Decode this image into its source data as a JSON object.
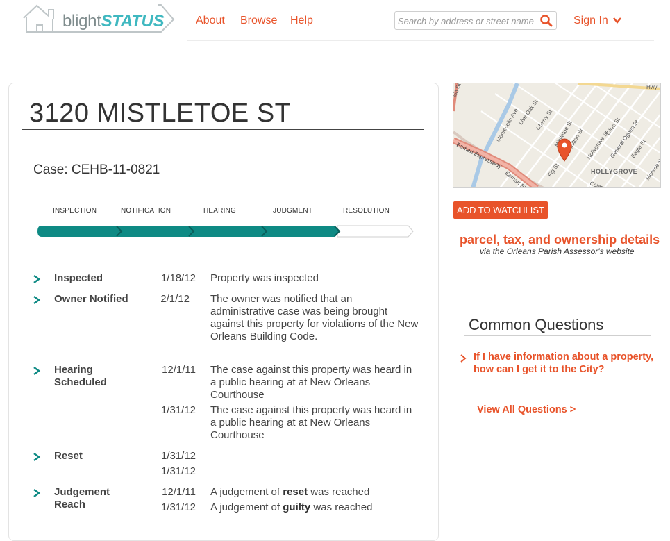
{
  "header": {
    "brand_part1": "blight",
    "brand_part2": "STATUS",
    "nav": [
      "About",
      "Browse",
      "Help"
    ],
    "search_placeholder": "Search by address or street name",
    "sign_in": "Sign In"
  },
  "property": {
    "address": "3120 MISTLETOE ST",
    "case_label": "Case: CEHB-11-0821"
  },
  "stages": {
    "labels": [
      "INSPECTION",
      "NOTIFICATION",
      "HEARING",
      "JUDGMENT",
      "RESOLUTION"
    ],
    "completed": 4,
    "total": 5
  },
  "timeline": [
    {
      "name_line1": "Inspected",
      "name_line2": "",
      "entries": [
        {
          "date": "1/18/12",
          "desc": "Property was inspected"
        }
      ]
    },
    {
      "name_line1": "Owner Notified",
      "name_line2": "",
      "entries": [
        {
          "date": "2/1/12",
          "desc": "The owner was notified that an administrative case was being brought against this property for violations of the New Orleans Building Code."
        }
      ]
    },
    {
      "name_line1": "Hearing",
      "name_line2": "Scheduled",
      "entries": [
        {
          "date": "12/1/11",
          "desc": "The case against this property was heard in a public hearing at at New Orleans Courthouse"
        },
        {
          "date": "1/31/12",
          "desc": "The case against this property was heard in a public hearing at at New Orleans Courthouse"
        }
      ]
    },
    {
      "name_line1": "Reset",
      "name_line2": "",
      "entries": [
        {
          "date": "1/31/12",
          "desc": ""
        },
        {
          "date": "1/31/12",
          "desc": ""
        }
      ]
    },
    {
      "name_line1": "Judgement",
      "name_line2": "Reach",
      "entries": [
        {
          "date": "12/1/11",
          "desc_prefix": "A judgement of ",
          "desc_bold": "reset",
          "desc_suffix": " was reached"
        },
        {
          "date": "1/31/12",
          "desc_prefix": "A judgement of ",
          "desc_bold": "guilty",
          "desc_suffix": " was reached"
        }
      ]
    }
  ],
  "map": {
    "streets": [
      "Live Oak St",
      "Montecello Ave",
      "Cherry St",
      "Mistletoe St",
      "Hamilton St",
      "Hollygrove St",
      "Olive St",
      "General Ogden St",
      "Eagle St",
      "Monroe St",
      "Fig St",
      "Earhart Expressway",
      "Earhart Blvd",
      "Colapissa",
      "Hwy"
    ],
    "neighborhood": "HOLLYGROVE"
  },
  "sidebar": {
    "watchlist_button": "ADD TO WATCHLIST",
    "parcel_link": "parcel, tax, and ownership details",
    "parcel_sub": "via the Orleans Parish Assessor's website",
    "cq_title": "Common Questions",
    "cq_question": "If I have information about a property, how can I get it to the City?",
    "cq_all": "View All Questions >"
  },
  "colors": {
    "accent": "#e8532a",
    "brand_teal": "#3fb8c0",
    "progress_teal": "#0e8a84",
    "text": "#333333"
  }
}
